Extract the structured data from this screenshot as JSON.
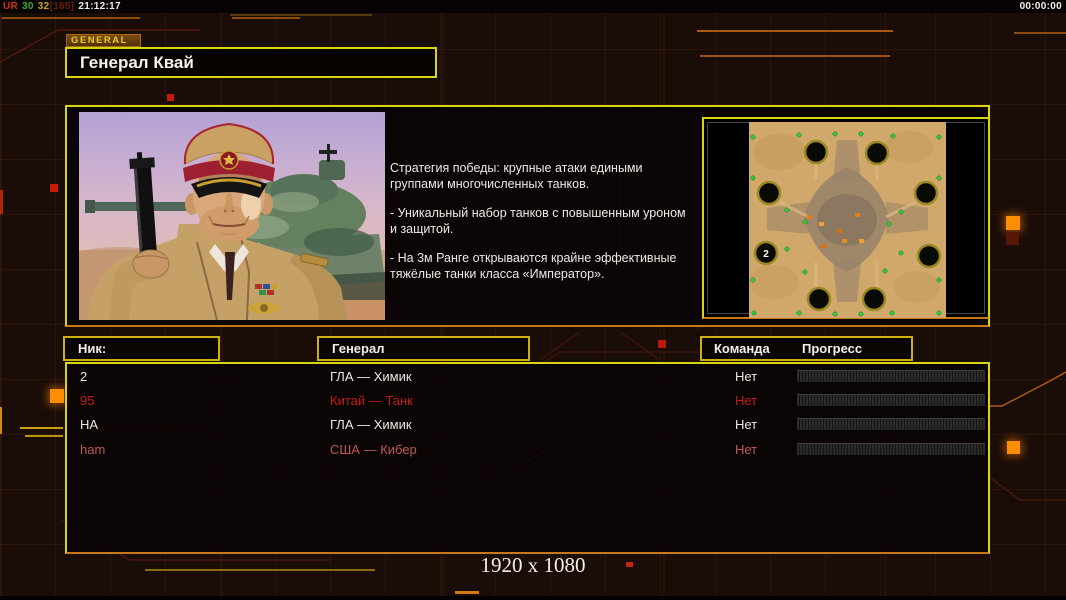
{
  "status_bar": {
    "session_parts": [
      {
        "text": "UR",
        "color": "#d23020"
      },
      {
        "text": "30",
        "color": "#3fae2a"
      },
      {
        "text": "32",
        "color": "#c8a41e"
      },
      {
        "text": "[165]",
        "color": "#6e1c10"
      },
      {
        "text": "21:12:17",
        "color": "#f0ece8"
      }
    ],
    "timer": "00:00:00"
  },
  "general_panel": {
    "tab_label": "GENERAL",
    "title": "Генерал Квай",
    "description_paragraphs": [
      "Стратегия победы: крупные атаки едиными\n группами многочисленных танков.",
      "- Уникальный набор танков с повышенным уроном\n и защитой.",
      "- На 3м Ранге открываются крайне эффективные\n тяжёлые танки класса «Император»."
    ]
  },
  "map_preview": {
    "start_marker": "2"
  },
  "players_table": {
    "headers": {
      "nick": "Ник:",
      "general": "Генерал",
      "team": "Команда",
      "progress": "Прогресс"
    },
    "rows": [
      {
        "nick": "2",
        "general": "ГЛА — Химик",
        "team": "Нет",
        "progress_percent": 0,
        "color": "#ece8e4"
      },
      {
        "nick": "95",
        "general": "Китай — Танк",
        "team": "Нет",
        "progress_percent": 0,
        "color": "#c41e12"
      },
      {
        "nick": "НА",
        "general": "ГЛА — Химик",
        "team": "Нет",
        "progress_percent": 0,
        "color": "#ece8e4"
      },
      {
        "nick": "ham",
        "general": "США — Кибер",
        "team": "Нет",
        "progress_percent": 0,
        "color": "#bc5a55"
      }
    ]
  },
  "footer": {
    "resolution_label": "1920 x 1080"
  },
  "theme": {
    "background": "#1a0d08",
    "border_yellow": "#d6d50e",
    "border_orange": "#c87818",
    "header_border": "#cfae10",
    "accent_red": "#c41c08",
    "accent_orange": "#ff8d00"
  }
}
